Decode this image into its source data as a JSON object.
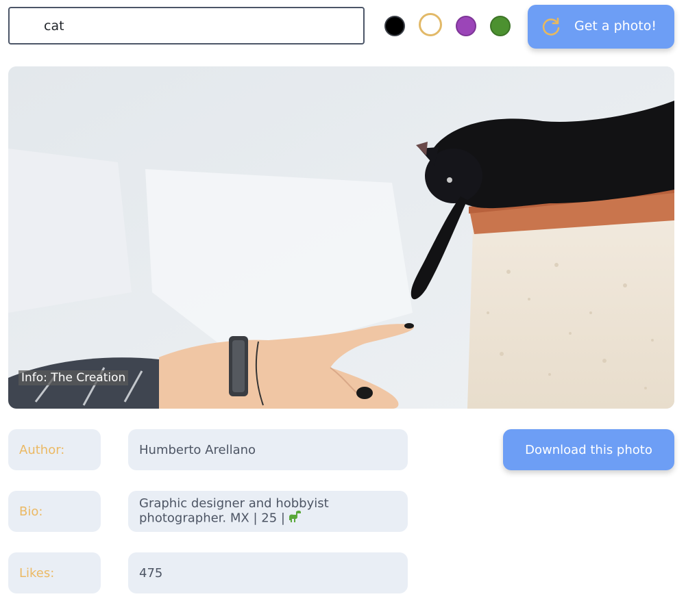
{
  "search": {
    "value": "cat"
  },
  "swatches": [
    {
      "name": "black",
      "color": "#000000"
    },
    {
      "name": "yellow",
      "color": "#e2b968"
    },
    {
      "name": "purple",
      "color": "#9b45b8"
    },
    {
      "name": "green",
      "color": "#4c9130"
    }
  ],
  "get_photo_button": {
    "label": "Get a photo!",
    "icon": "refresh-icon"
  },
  "photo": {
    "caption": "Info: The Creation"
  },
  "details": {
    "author_label": "Author:",
    "author_value": "Humberto Arellano",
    "bio_label": "Bio:",
    "bio_value": "Graphic designer and hobbyist photographer. MX | 25 |",
    "bio_icon": "dinosaur-icon",
    "likes_label": "Likes:",
    "likes_value": "475"
  },
  "download_button": {
    "label": "Download this photo"
  },
  "colors": {
    "accent": "#6d9ef5",
    "label_text": "#ebb964",
    "cell_bg": "#e9eef5"
  }
}
